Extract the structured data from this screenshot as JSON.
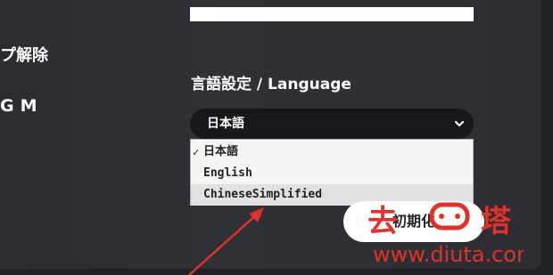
{
  "sidebar": {
    "unlock_label": "プ解除",
    "bgm_label": "GM"
  },
  "language": {
    "heading": "言語設定 / Language",
    "selected": "日本語",
    "options": [
      {
        "label": "日本語",
        "checked": true
      },
      {
        "label": "English",
        "checked": false
      },
      {
        "label": "ChineseSimplified",
        "checked": false
      }
    ],
    "check_mark": "✓"
  },
  "reset_button": {
    "label": "初期化"
  },
  "watermark": {
    "brand": "去塔",
    "url": "www.diuta.com"
  },
  "colors": {
    "accent_red": "#e0312a",
    "panel": "#2f3136",
    "select_bg": "#17181b"
  }
}
